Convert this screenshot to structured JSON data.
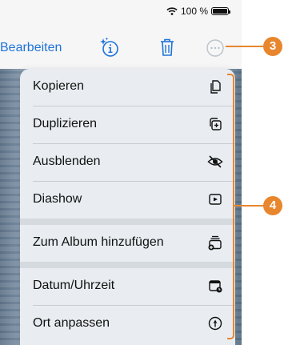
{
  "statusbar": {
    "battery_text": "100 %"
  },
  "toolbar": {
    "edit_label": "Bearbeiten"
  },
  "menu": {
    "items": [
      {
        "label": "Kopieren",
        "icon": "copy-icon"
      },
      {
        "label": "Duplizieren",
        "icon": "duplicate-icon"
      },
      {
        "label": "Ausblenden",
        "icon": "hide-icon"
      },
      {
        "label": "Diashow",
        "icon": "slideshow-icon"
      },
      {
        "label": "Zum Album hinzufügen",
        "icon": "add-to-album-icon"
      },
      {
        "label": "Datum/Uhrzeit",
        "icon": "date-time-icon"
      },
      {
        "label": "Ort anpassen",
        "icon": "adjust-location-icon"
      }
    ]
  },
  "callouts": {
    "more_badge": "3",
    "menu_badge": "4"
  },
  "colors": {
    "accent": "#1f73d8",
    "callout": "#e8862e"
  }
}
